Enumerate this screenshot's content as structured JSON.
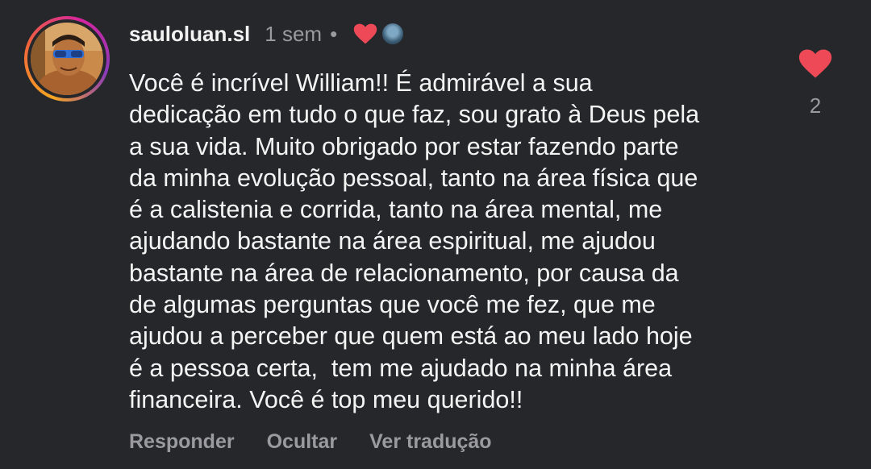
{
  "comment": {
    "username": "sauloluan.sl",
    "time": "1 sem",
    "separator": "•",
    "text": "Você é incrível William!! É admirável a sua\ndedicação em tudo o que faz, sou grato à Deus pela\na sua vida. Muito obrigado por estar fazendo parte\nda minha evolução pessoal, tanto na área física que\né a calistenia e corrida, tanto na área mental, me\najudando bastante na área espiritual, me ajudou\nbastante na área de relacionamento, por causa da\nde algumas perguntas que você me fez, que me\najudou a perceber que quem está ao meu lado hoje\né a pessoa certa,  tem me ajudado na minha área\nfinanceira. Você é top meu querido!!",
    "like_count": "2"
  },
  "actions": {
    "reply": "Responder",
    "hide": "Ocultar",
    "translate": "Ver tradução"
  },
  "colors": {
    "background": "#26272b",
    "heart": "#ed4956",
    "muted": "#9a9aa0",
    "text": "#f4f4f4"
  },
  "icons": {
    "creator_like": "heart-icon",
    "like": "heart-icon",
    "avatar": "profile-avatar"
  }
}
